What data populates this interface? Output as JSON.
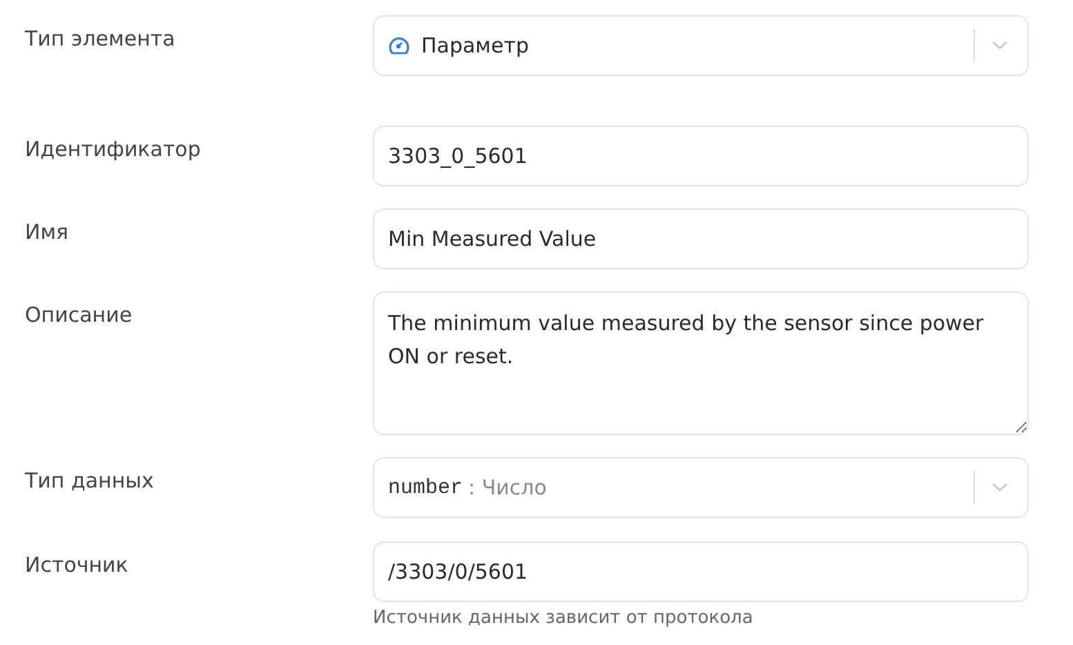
{
  "fields": [
    {
      "kind": "select",
      "label": "Тип элемента",
      "value": "Параметр",
      "disabled": false
    },
    {
      "kind": "input",
      "label": "Идентификатор",
      "value": "3303_0_5601"
    },
    {
      "kind": "input",
      "label": "Имя",
      "value": "Min Measured Value"
    },
    {
      "kind": "textarea",
      "label": "Описание",
      "value": "The minimum value measured by the sensor since power ON or reset."
    },
    {
      "kind": "select",
      "label": "Тип данных",
      "code": "number",
      "value": ": Число",
      "disabled": true
    },
    {
      "kind": "input",
      "label": "Источник",
      "value": "/3303/0/5601",
      "hint": "Источник данных зависит от протокола"
    }
  ]
}
